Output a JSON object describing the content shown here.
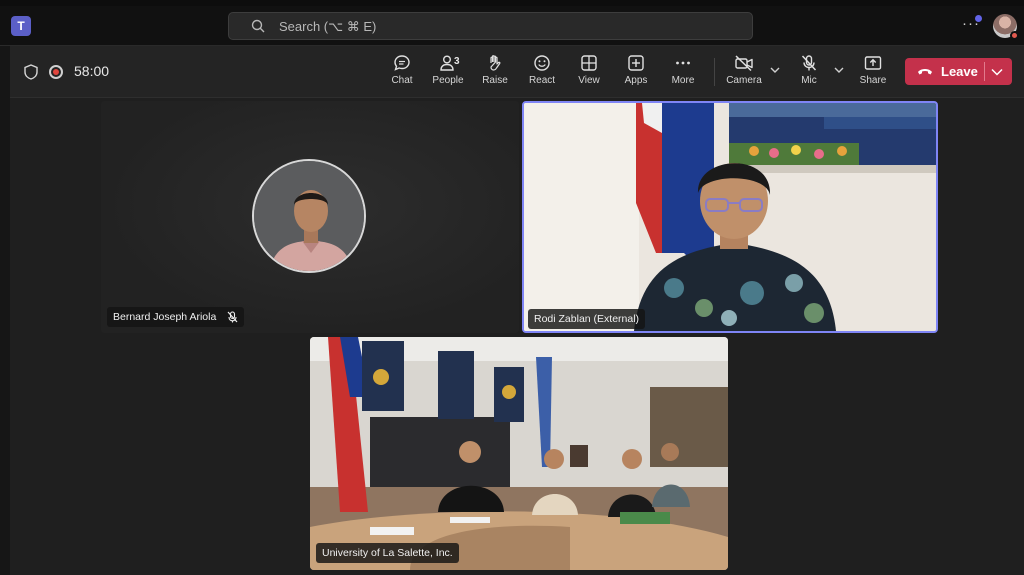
{
  "app": {
    "logo_letter": "T"
  },
  "search": {
    "placeholder": "Search (⌥ ⌘ E)"
  },
  "titlebar": {
    "more": "···"
  },
  "meeting": {
    "timer": "58:00",
    "toolbar": {
      "chat": "Chat",
      "people": "People",
      "people_count": "3",
      "raise": "Raise",
      "react": "React",
      "view": "View",
      "apps": "Apps",
      "more": "More",
      "camera": "Camera",
      "mic": "Mic",
      "share": "Share",
      "leave": "Leave"
    }
  },
  "participants": [
    {
      "name": "Bernard Joseph Ariola",
      "muted": true
    },
    {
      "name": "Rodi Zablan (External)",
      "active_speaker": true
    },
    {
      "name": "University of La Salette, Inc."
    }
  ],
  "colors": {
    "leave_button": "#c4314b",
    "active_speaker_border": "#7f85f5",
    "teams_brand": "#5b5fc7",
    "record_dot": "#e0453d"
  }
}
